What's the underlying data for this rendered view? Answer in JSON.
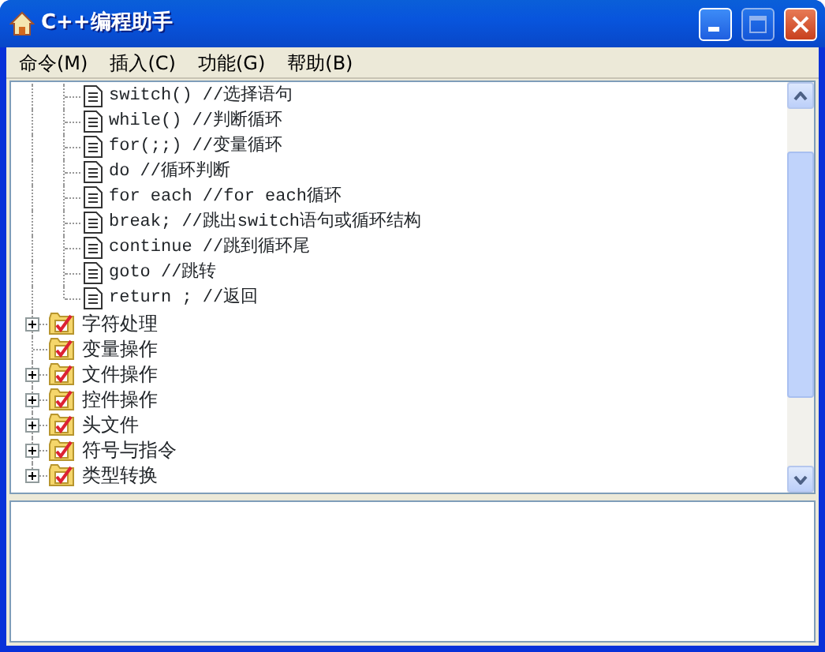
{
  "window": {
    "title": "C++编程助手",
    "maximize_disabled": true
  },
  "menu": [
    "命令(M)",
    "插入(C)",
    "功能(G)",
    "帮助(B)"
  ],
  "tree": {
    "statements": [
      {
        "label": "switch() //选择语句"
      },
      {
        "label": "while() //判断循环"
      },
      {
        "label": "for(;;) //变量循环"
      },
      {
        "label": "do //循环判断"
      },
      {
        "label": "for each //for each循环"
      },
      {
        "label": "break; //跳出switch语句或循环结构"
      },
      {
        "label": "continue //跳到循环尾"
      },
      {
        "label": "goto //跳转"
      },
      {
        "label": "return ; //返回"
      }
    ],
    "categories": [
      {
        "label": "字符处理",
        "expandable": true
      },
      {
        "label": "变量操作",
        "expandable": false
      },
      {
        "label": "文件操作",
        "expandable": true
      },
      {
        "label": "控件操作",
        "expandable": true
      },
      {
        "label": "头文件",
        "expandable": true
      },
      {
        "label": "符号与指令",
        "expandable": true
      },
      {
        "label": "类型转换",
        "expandable": true
      }
    ]
  }
}
